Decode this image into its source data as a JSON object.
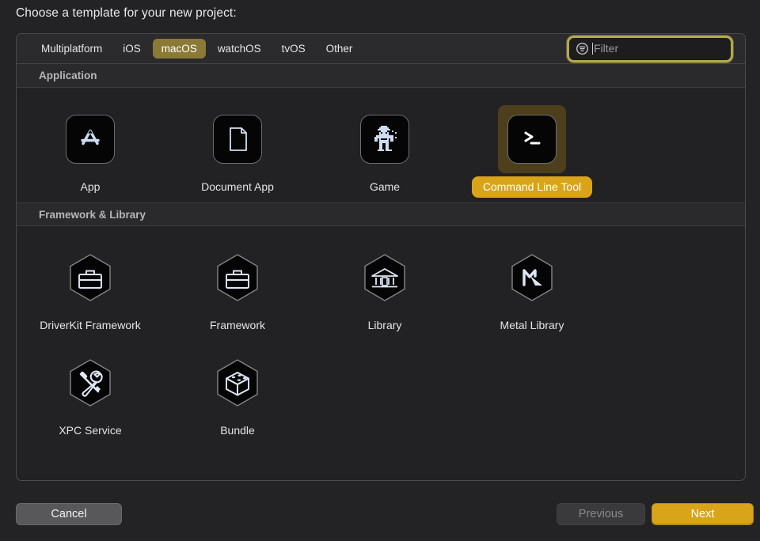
{
  "prompt": "Choose a template for your new project:",
  "tabs": [
    {
      "label": "Multiplatform",
      "selected": false
    },
    {
      "label": "iOS",
      "selected": false
    },
    {
      "label": "macOS",
      "selected": true
    },
    {
      "label": "watchOS",
      "selected": false
    },
    {
      "label": "tvOS",
      "selected": false
    },
    {
      "label": "Other",
      "selected": false
    }
  ],
  "filter": {
    "placeholder": "Filter",
    "value": "",
    "icon": "filter-circle-icon",
    "focused": true
  },
  "sections": [
    {
      "title": "Application",
      "items": [
        {
          "label": "App",
          "icon": "app-store-logo-icon",
          "selected": false
        },
        {
          "label": "Document App",
          "icon": "document-page-icon",
          "selected": false
        },
        {
          "label": "Game",
          "icon": "pixel-robot-icon",
          "selected": false
        },
        {
          "label": "Command Line Tool",
          "icon": "terminal-prompt-icon",
          "selected": true
        }
      ]
    },
    {
      "title": "Framework & Library",
      "items": [
        {
          "label": "DriverKit Framework",
          "icon": "hex-toolbox-icon",
          "selected": false
        },
        {
          "label": "Framework",
          "icon": "hex-toolbox-icon",
          "selected": false
        },
        {
          "label": "Library",
          "icon": "hex-bank-columns-icon",
          "selected": false
        },
        {
          "label": "Metal Library",
          "icon": "hex-metal-logo-icon",
          "selected": false
        },
        {
          "label": "XPC Service",
          "icon": "hex-tools-icon",
          "selected": false
        },
        {
          "label": "Bundle",
          "icon": "hex-cube-icon",
          "selected": false
        }
      ]
    }
  ],
  "buttons": {
    "cancel": "Cancel",
    "previous": "Previous",
    "next": "Next"
  },
  "colors": {
    "accent": "#d9a41a",
    "tab_selected": "#8a7a36",
    "selection_icon_bg": "#4d3f1c",
    "focus_ring": "#bab050",
    "panel_bg": "#222224",
    "window_bg": "#232325"
  }
}
